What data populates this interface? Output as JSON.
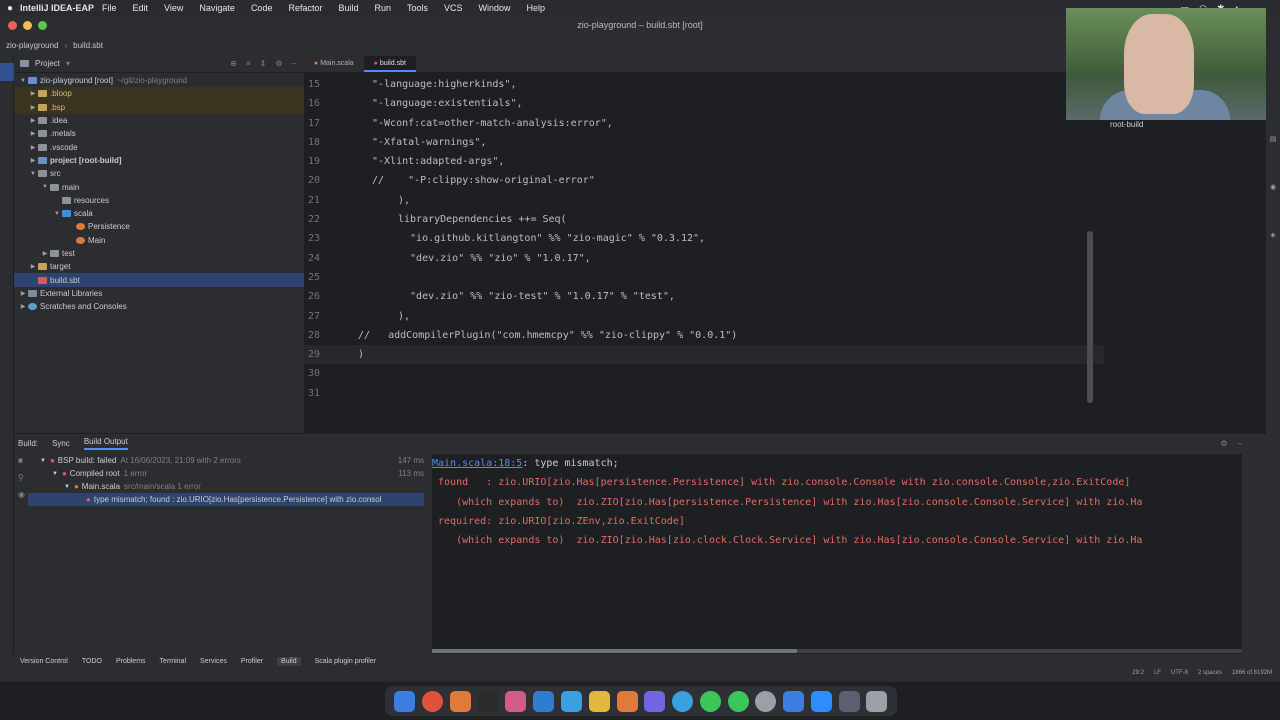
{
  "menubar": {
    "app": "IntelliJ IDEA-EAP",
    "items": [
      "File",
      "Edit",
      "View",
      "Navigate",
      "Code",
      "Refactor",
      "Build",
      "Run",
      "Tools",
      "VCS",
      "Window",
      "Help"
    ]
  },
  "window": {
    "title": "zio-playground – build.sbt [root]"
  },
  "navbar": {
    "project": "zio-playground",
    "file": "build.sbt"
  },
  "project_panel": {
    "title": "Project",
    "root": "zio-playground [root]",
    "root_path": "~/git/zio-playground",
    "items": [
      {
        "label": ".bloop",
        "indent": 1
      },
      {
        "label": ".bsp",
        "indent": 1
      },
      {
        "label": ".idea",
        "indent": 1
      },
      {
        "label": ".metals",
        "indent": 1
      },
      {
        "label": ".vscode",
        "indent": 1
      },
      {
        "label": "project [root-build]",
        "indent": 1
      },
      {
        "label": "src",
        "indent": 1
      },
      {
        "label": "main",
        "indent": 2
      },
      {
        "label": "resources",
        "indent": 3
      },
      {
        "label": "scala",
        "indent": 3
      },
      {
        "label": "Persistence",
        "indent": 4
      },
      {
        "label": "Main",
        "indent": 4
      },
      {
        "label": "test",
        "indent": 2
      },
      {
        "label": "target",
        "indent": 1
      },
      {
        "label": "build.sbt",
        "indent": 1
      },
      {
        "label": "External Libraries",
        "indent": 0
      },
      {
        "label": "Scratches and Consoles",
        "indent": 0
      }
    ]
  },
  "tabs": [
    {
      "label": "Main.scala"
    },
    {
      "label": "build.sbt"
    }
  ],
  "code": {
    "lines": [
      {
        "n": "15",
        "text": "\"-language:higherkinds\","
      },
      {
        "n": "16",
        "text": "\"-language:existentials\","
      },
      {
        "n": "17",
        "text": "\"-Wconf:cat=other-match-analysis:error\","
      },
      {
        "n": "18",
        "text": "\"-Xfatal-warnings\","
      },
      {
        "n": "19",
        "text": "\"-Xlint:adapted-args\","
      },
      {
        "n": "20",
        "text": "//    \"-P:clippy:show-original-error\""
      },
      {
        "n": "21",
        "text": "),"
      },
      {
        "n": "22",
        "text": "libraryDependencies ++= Seq("
      },
      {
        "n": "23",
        "text": "  \"io.github.kitlangton\" %% \"zio-magic\" % \"0.3.12\","
      },
      {
        "n": "24",
        "text": "  \"dev.zio\" %% \"zio\" % \"1.0.17\","
      },
      {
        "n": "25",
        "text": ""
      },
      {
        "n": "26",
        "text": "  \"dev.zio\" %% \"zio-test\" % \"1.0.17\" % \"test\","
      },
      {
        "n": "27",
        "text": "),"
      },
      {
        "n": "28",
        "text": "//   addCompilerPlugin(\"com.hmemcpy\" %% \"zio-clippy\" % \"0.0.1\")"
      },
      {
        "n": "29",
        "text": ")"
      },
      {
        "n": "30",
        "text": ""
      },
      {
        "n": "31",
        "text": ""
      }
    ]
  },
  "webcam": {
    "label": "root-build"
  },
  "build_panel": {
    "label": "Build:",
    "tabs": [
      "Sync",
      "Build Output"
    ],
    "tree": [
      {
        "label": "BSP build: failed",
        "detail": "At 16/06/2023, 21:09 with 2 errors",
        "time": "147 ms"
      },
      {
        "label": "Compiled root",
        "detail": "1 error",
        "time": "113 ms"
      },
      {
        "label": "Main.scala",
        "detail": "src/main/scala 1 error",
        "time": ""
      },
      {
        "label": "type mismatch;  found   : zio.URIO[zio.Has[persistence.Persistence] with zio.consol",
        "detail": "",
        "time": ""
      }
    ],
    "output": {
      "link": "Main.scala:18:5",
      "first": ": type mismatch;",
      "lines": [
        " found   : zio.URIO[zio.Has[persistence.Persistence] with zio.console.Console with zio.console.Console,zio.ExitCode]",
        "    (which expands to)  zio.ZIO[zio.Has[persistence.Persistence] with zio.Has[zio.console.Console.Service] with zio.Ha",
        " required: zio.URIO[zio.ZEnv,zio.ExitCode]",
        "    (which expands to)  zio.ZIO[zio.Has[zio.clock.Clock.Service] with zio.Has[zio.console.Console.Service] with zio.Ha"
      ]
    }
  },
  "statusbar": {
    "items": [
      "Version Control",
      "TODO",
      "Problems",
      "Terminal",
      "Services",
      "Profiler",
      "Build",
      "Scala plugin profiler"
    ]
  },
  "bottom_status": {
    "pos": "29:2",
    "le": "LF",
    "enc": "UTF-8",
    "indent": "2 spaces",
    "mem": "1866 of 8192M"
  }
}
